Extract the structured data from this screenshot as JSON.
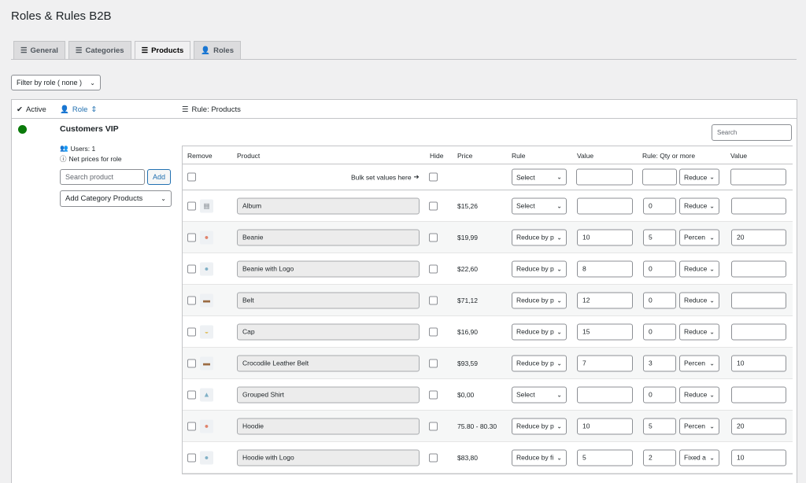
{
  "title": "Roles & Rules B2B",
  "tabs": [
    {
      "label": "General",
      "icon": "sliders-icon",
      "active": false
    },
    {
      "label": "Categories",
      "icon": "sliders-icon",
      "active": false
    },
    {
      "label": "Products",
      "icon": "sliders-icon",
      "active": true
    },
    {
      "label": "Roles",
      "icon": "users-icon",
      "active": false
    }
  ],
  "filter": {
    "label": "Filter by role ( none )"
  },
  "panel_header": {
    "active": "Active",
    "role": "Role",
    "rule": "Rule: Products"
  },
  "role": {
    "name": "Customers VIP",
    "users": "Users: 1",
    "net_prices": "Net prices for role",
    "search_placeholder": "Search product",
    "add_label": "Add",
    "add_category": "Add Category Products",
    "status_color": "#0a7a0a"
  },
  "search": {
    "placeholder": "Search"
  },
  "columns": [
    "Remove",
    "Product",
    "Hide",
    "Price",
    "Rule",
    "Value",
    "Rule: Qty or more",
    "Value"
  ],
  "bulk": {
    "label": "Bulk set values here",
    "rule": "Select",
    "qty_rule": "Reduce"
  },
  "rows": [
    {
      "name": "Album",
      "price": "$15,26",
      "rule": "Select",
      "value": "",
      "qty": "0",
      "qty_rule": "Reduce",
      "value2": "",
      "icon": "album-icon"
    },
    {
      "name": "Beanie",
      "price": "$19,99",
      "rule": "Reduce by p",
      "value": "10",
      "qty": "5",
      "qty_rule": "Percen",
      "value2": "20",
      "icon": "beanie-icon"
    },
    {
      "name": "Beanie with Logo",
      "price": "$22,60",
      "rule": "Reduce by p",
      "value": "8",
      "qty": "0",
      "qty_rule": "Reduce",
      "value2": "",
      "icon": "beanie-logo-icon"
    },
    {
      "name": "Belt",
      "price": "$71,12",
      "rule": "Reduce by p",
      "value": "12",
      "qty": "0",
      "qty_rule": "Reduce",
      "value2": "",
      "icon": "belt-icon"
    },
    {
      "name": "Cap",
      "price": "$16,90",
      "rule": "Reduce by p",
      "value": "15",
      "qty": "0",
      "qty_rule": "Reduce",
      "value2": "",
      "icon": "cap-icon"
    },
    {
      "name": "Crocodile Leather Belt",
      "price": "$93,59",
      "rule": "Reduce by p",
      "value": "7",
      "qty": "3",
      "qty_rule": "Percen",
      "value2": "10",
      "icon": "croc-belt-icon"
    },
    {
      "name": "Grouped Shirt",
      "price": "$0,00",
      "rule": "Select",
      "value": "",
      "qty": "0",
      "qty_rule": "Reduce",
      "value2": "",
      "icon": "shirt-icon"
    },
    {
      "name": "Hoodie",
      "price": "75.80 - 80.30",
      "rule": "Reduce by p",
      "value": "10",
      "qty": "5",
      "qty_rule": "Percen",
      "value2": "20",
      "icon": "hoodie-icon"
    },
    {
      "name": "Hoodie with Logo",
      "price": "$83,80",
      "rule": "Reduce by fi",
      "value": "5",
      "qty": "2",
      "qty_rule": "Fixed a",
      "value2": "10",
      "icon": "hoodie-logo-icon"
    }
  ]
}
